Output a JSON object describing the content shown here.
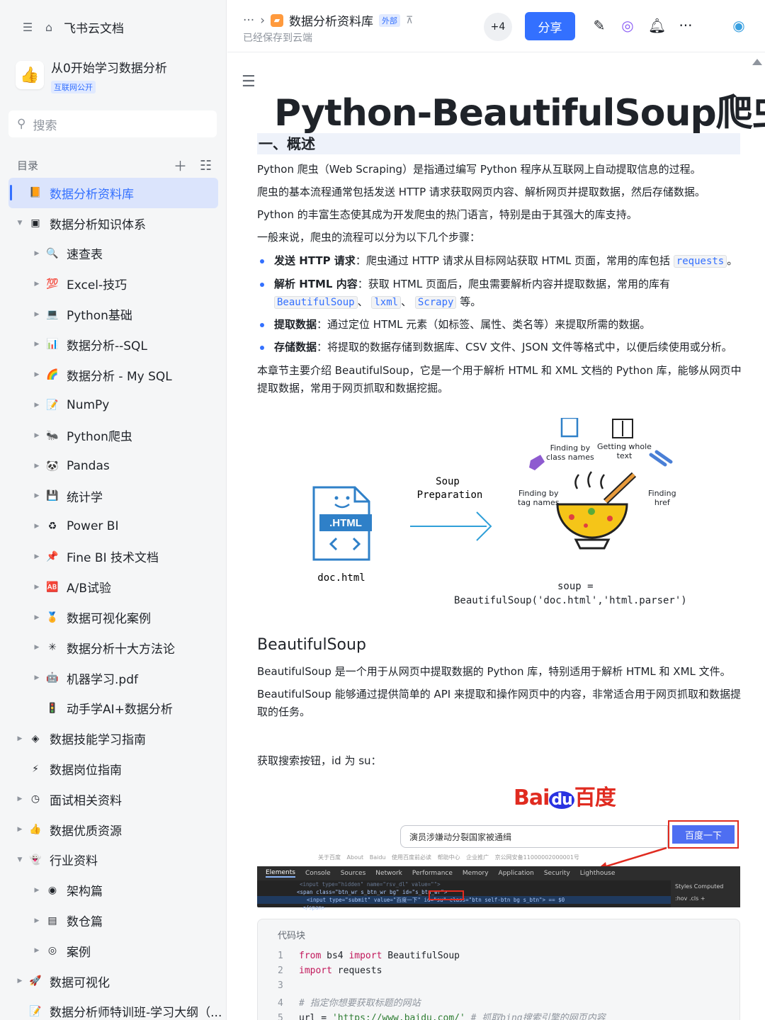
{
  "sidebar": {
    "app_title": "飞书云文档",
    "kb_title": "从0开始学习数据分析",
    "kb_tag": "互联网公开",
    "search_placeholder": "搜索",
    "toc_label": "目录",
    "items": [
      {
        "label": "数据分析资料库",
        "icon": "📙",
        "level": 0,
        "arrow": "",
        "selected": true
      },
      {
        "label": "数据分析知识体系",
        "icon": "▣",
        "level": 0,
        "arrow": "▼"
      },
      {
        "label": "速查表",
        "icon": "🔍",
        "level": 1,
        "arrow": "▶"
      },
      {
        "label": "Excel-技巧",
        "icon": "💯",
        "level": 1,
        "arrow": "▶"
      },
      {
        "label": "Python基础",
        "icon": "💻",
        "level": 1,
        "arrow": "▶"
      },
      {
        "label": "数据分析--SQL",
        "icon": "📊",
        "level": 1,
        "arrow": "▶"
      },
      {
        "label": "数据分析 - My SQL",
        "icon": "🌈",
        "level": 1,
        "arrow": "▶"
      },
      {
        "label": "NumPy",
        "icon": "📝",
        "level": 1,
        "arrow": "▶"
      },
      {
        "label": "Python爬虫",
        "icon": "🐜",
        "level": 1,
        "arrow": "▶"
      },
      {
        "label": "Pandas",
        "icon": "🐼",
        "level": 1,
        "arrow": "▶"
      },
      {
        "label": "统计学",
        "icon": "💾",
        "level": 1,
        "arrow": "▶"
      },
      {
        "label": "Power BI",
        "icon": "♻",
        "level": 1,
        "arrow": "▶"
      },
      {
        "label": "Fine BI 技术文档",
        "icon": "📌",
        "level": 1,
        "arrow": "▶"
      },
      {
        "label": "A/B试验",
        "icon": "🆎",
        "level": 1,
        "arrow": "▶"
      },
      {
        "label": "数据可视化案例",
        "icon": "🏅",
        "level": 1,
        "arrow": "▶"
      },
      {
        "label": "数据分析十大方法论",
        "icon": "✳",
        "level": 1,
        "arrow": "▶"
      },
      {
        "label": "机器学习.pdf",
        "icon": "🤖",
        "level": 1,
        "arrow": "▶"
      },
      {
        "label": "动手学AI+数据分析",
        "icon": "🚦",
        "level": 1,
        "arrow": ""
      },
      {
        "label": "数据技能学习指南",
        "icon": "◈",
        "level": 0,
        "arrow": "▶"
      },
      {
        "label": "数据岗位指南",
        "icon": "⚡",
        "level": 0,
        "arrow": ""
      },
      {
        "label": "面试相关资料",
        "icon": "◷",
        "level": 0,
        "arrow": "▶"
      },
      {
        "label": "数据优质资源",
        "icon": "👍",
        "level": 0,
        "arrow": "▶"
      },
      {
        "label": "行业资料",
        "icon": "👻",
        "level": 0,
        "arrow": "▼"
      },
      {
        "label": "架构篇",
        "icon": "◉",
        "level": 1,
        "arrow": "▶"
      },
      {
        "label": "数仓篇",
        "icon": "▤",
        "level": 1,
        "arrow": "▶"
      },
      {
        "label": "案例",
        "icon": "◎",
        "level": 1,
        "arrow": "▶"
      },
      {
        "label": "数据可视化",
        "icon": "🚀",
        "level": 0,
        "arrow": "▶"
      },
      {
        "label": "数据分析师特训班-学习大纲（...",
        "icon": "📝",
        "level": 0,
        "arrow": ""
      }
    ]
  },
  "header": {
    "breadcrumb": "数据分析资料库",
    "external_tag": "外部",
    "saved_text": "已经保存到云端",
    "collaborators": "+4",
    "share_label": "分享"
  },
  "doc": {
    "title": "Python-BeautifulSoup爬虫",
    "section1": "一、概述",
    "p1": "Python 爬虫（Web Scraping）是指通过编写 Python 程序从互联网上自动提取信息的过程。",
    "p2": "爬虫的基本流程通常包括发送 HTTP 请求获取网页内容、解析网页并提取数据，然后存储数据。",
    "p3": "Python 的丰富生态使其成为开发爬虫的热门语言，特别是由于其强大的库支持。",
    "p4": "一般来说，爬虫的流程可以分为以下几个步骤：",
    "b1_bold": "发送 HTTP 请求",
    "b1_text": "：爬虫通过 HTTP 请求从目标网站获取 HTML 页面，常用的库包括",
    "b1_code": "requests",
    "b1_end": "。",
    "b2_bold": "解析 HTML 内容",
    "b2_text": "：获取 HTML 页面后，爬虫需要解析内容并提取数据，常用的库有",
    "b2_code1": "BeautifulSoup",
    "b2_code2": "lxml",
    "b2_code3": "Scrapy",
    "b2_sep": "、",
    "b2_end": "等。",
    "b3_bold": "提取数据",
    "b3_text": "：通过定位 HTML 元素（如标签、属性、类名等）来提取所需的数据。",
    "b4_bold": "存储数据",
    "b4_text": "：将提取的数据存储到数据库、CSV 文件、JSON 文件等格式中，以便后续使用或分析。",
    "p5": "本章节主要介绍 BeautifulSoup，它是一个用于解析 HTML 和 XML 文档的 Python 库，能够从网页中提取数据，常用于网页抓取和数据挖掘。",
    "h3": "BeautifulSoup",
    "p6": "BeautifulSoup 是一个用于从网页中提取数据的 Python 库，特别适用于解析 HTML 和 XML 文件。",
    "p7": "BeautifulSoup 能够通过提供简单的 API 来提取和操作网页中的内容，非常适合用于网页抓取和数据提取的任务。",
    "p8": "获取搜索按钮，id 为 su："
  },
  "diagram": {
    "html_label": ".HTML",
    "doc_file": "doc.html",
    "prep_line1": "Soup",
    "prep_line2": "Preparation",
    "class_line1": "Finding by",
    "class_line2": "class names",
    "text_line1": "Getting whole",
    "text_line2": "text",
    "tag_line1": "Finding by",
    "tag_line2": "tag names",
    "href_line1": "Finding",
    "href_line2": "href",
    "soup_line1": "soup =",
    "soup_line2": "BeautifulSoup('doc.html','html.parser')"
  },
  "baidu": {
    "logo_bai": "Bai",
    "logo_du": "du",
    "logo_cn": "百度",
    "query": "演员涉嫌动分裂国家被通缉",
    "button": "百度一下",
    "links": "关于百度 About Baidu 使用百度前必读 帮助中心 企业推广 京公网安备11000002000001号",
    "devtools_tabs": [
      "Elements",
      "Console",
      "Sources",
      "Network",
      "Performance",
      "Memory",
      "Application",
      "Security",
      "Lighthouse"
    ],
    "dom_line1": "<input type=\"hidden\" name=\"rsv_dl\" value=\"\">",
    "dom_line2": "<span class=\"btn_wr s_btn_wr bg\" id=\"s_btn_wr\">",
    "dom_line3": "<input type=\"submit\" value=\"百度一下\" id=\"su\" class=\"btn self-btn bg s_btn\"> == $0",
    "dom_line4": "</span>",
    "side_tabs": "Styles  Computed",
    "side_filter": ":hov .cls +"
  },
  "code": {
    "label": "代码块",
    "lines": [
      {
        "n": "1",
        "kw1": "from",
        "t1": " bs4 ",
        "kw2": "import",
        "t2": " BeautifulSoup"
      },
      {
        "n": "2",
        "kw1": "import",
        "t1": " requests",
        "kw2": "",
        "t2": ""
      },
      {
        "n": "3",
        "kw1": "",
        "t1": "",
        "kw2": "",
        "t2": ""
      },
      {
        "n": "4",
        "cm": "# 指定你想要获取标题的网站"
      },
      {
        "n": "5",
        "t1": "url = ",
        "st": "'https://www.baidu.com/'",
        "cm": " # 抓取bing搜索引擎的网页内容"
      }
    ]
  },
  "colors": {
    "accent": "#3370ff",
    "baidu_red": "#e02b20",
    "baidu_blue": "#4e6ef2"
  }
}
